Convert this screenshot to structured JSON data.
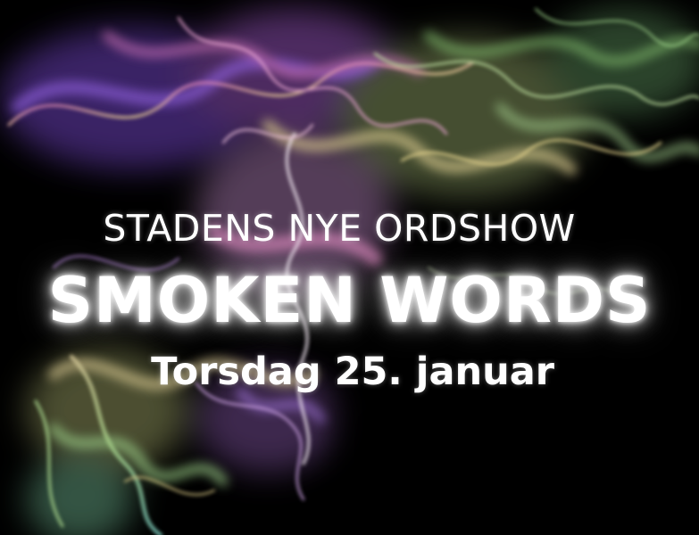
{
  "poster": {
    "subtitle": "STADENS NYE ORDSHOW",
    "title": "SMOKEN WORDS",
    "date": "Torsdag 25. januar"
  },
  "colors": {
    "background": "#000000",
    "text": "#ffffff",
    "smoke_purple": "#8a5cd6",
    "smoke_pink": "#e07ab8",
    "smoke_green": "#9fd38a",
    "smoke_yellow": "#e8d98a",
    "smoke_teal": "#7fd1c4"
  }
}
